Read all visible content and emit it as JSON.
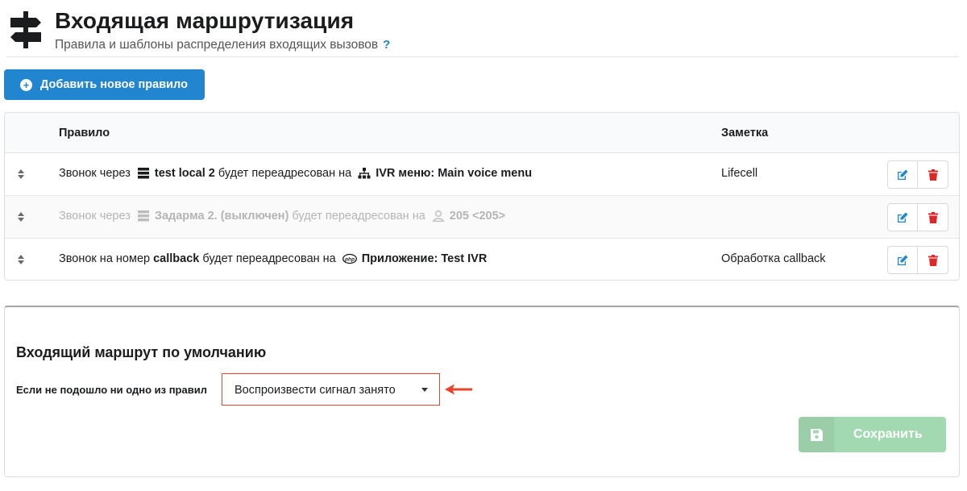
{
  "header": {
    "icon": "signpost-icon",
    "title": "Входящая маршрутизация",
    "subtitle": "Правила и шаблоны распределения входящих вызовов",
    "help": "?"
  },
  "toolbar": {
    "add_icon": "plus-circle-icon",
    "add_label": "Добавить новое правило"
  },
  "table": {
    "columns": [
      "Правило",
      "Заметка"
    ],
    "rows": [
      {
        "enabled": true,
        "prefix": "Звонок через",
        "provider_icon": "server-icon",
        "provider": "test local 2",
        "middle": "будет переадресован на",
        "target_icon": "sitemap-icon",
        "target": "IVR меню: Main voice menu",
        "note": "Lifecell"
      },
      {
        "enabled": false,
        "prefix": "Звонок через",
        "provider_icon": "server-icon",
        "provider": "Задарма 2. (выключен)",
        "middle": "будет переадресован на",
        "target_icon": "user-icon",
        "target": "205 <205>",
        "note": ""
      },
      {
        "enabled": true,
        "prefix": "Звонок на номер",
        "provider_icon": "",
        "provider": "callback",
        "middle": "будет переадресован на",
        "target_icon": "php-icon",
        "target": "Приложение: Test IVR",
        "note": "Обработка callback"
      }
    ],
    "php_glyph": "php"
  },
  "default_route": {
    "title": "Входящий маршрут по умолчанию",
    "label": "Если не подошло ни одно из правил",
    "selected": "Воспроизвести сигнал занято",
    "save_label": "Сохранить"
  },
  "colors": {
    "primary": "#2185d0",
    "danger": "#db2828",
    "save_disabled": "#a3d9b1",
    "highlight": "#e8432b"
  }
}
